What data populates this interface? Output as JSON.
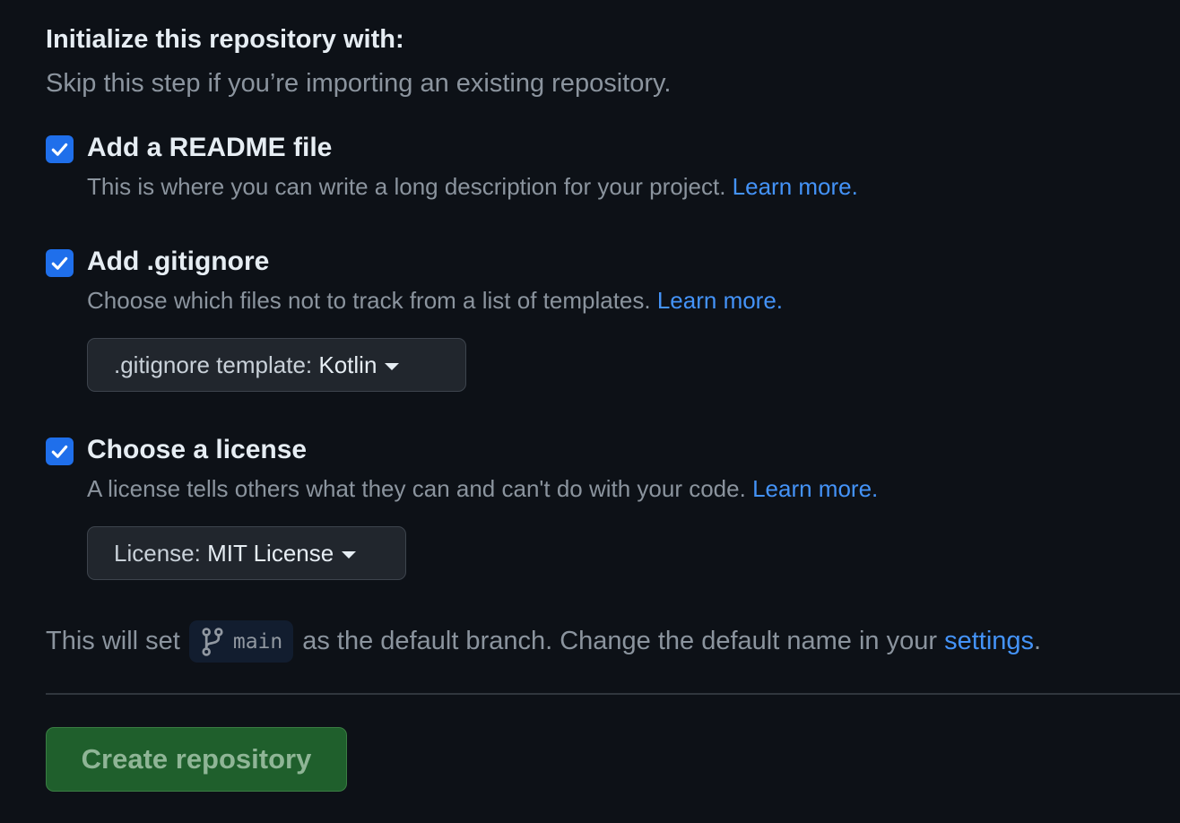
{
  "section": {
    "title": "Initialize this repository with:",
    "subtitle": "Skip this step if you’re importing an existing repository."
  },
  "options": {
    "readme": {
      "checked": true,
      "label": "Add a README file",
      "description": "This is where you can write a long description for your project.",
      "link": "Learn more."
    },
    "gitignore": {
      "checked": true,
      "label": "Add .gitignore",
      "description": "Choose which files not to track from a list of templates.",
      "link": "Learn more.",
      "select_prefix": ".gitignore template: ",
      "select_value": "Kotlin"
    },
    "license": {
      "checked": true,
      "label": "Choose a license",
      "description": "A license tells others what they can and can't do with your code.",
      "link": "Learn more.",
      "select_prefix": "License: ",
      "select_value": "MIT License"
    }
  },
  "branch_note": {
    "prefix": "This will set",
    "branch_icon": "git-branch-icon",
    "branch": "main",
    "middle": "as the default branch. Change the default name in your",
    "link": "settings",
    "suffix": "."
  },
  "create_button": {
    "label": "Create repository",
    "enabled": false
  },
  "colors": {
    "background": "#0d1117",
    "checkbox": "#1f6feb",
    "link": "#4493f8",
    "create_button": "#1f5f2c"
  }
}
